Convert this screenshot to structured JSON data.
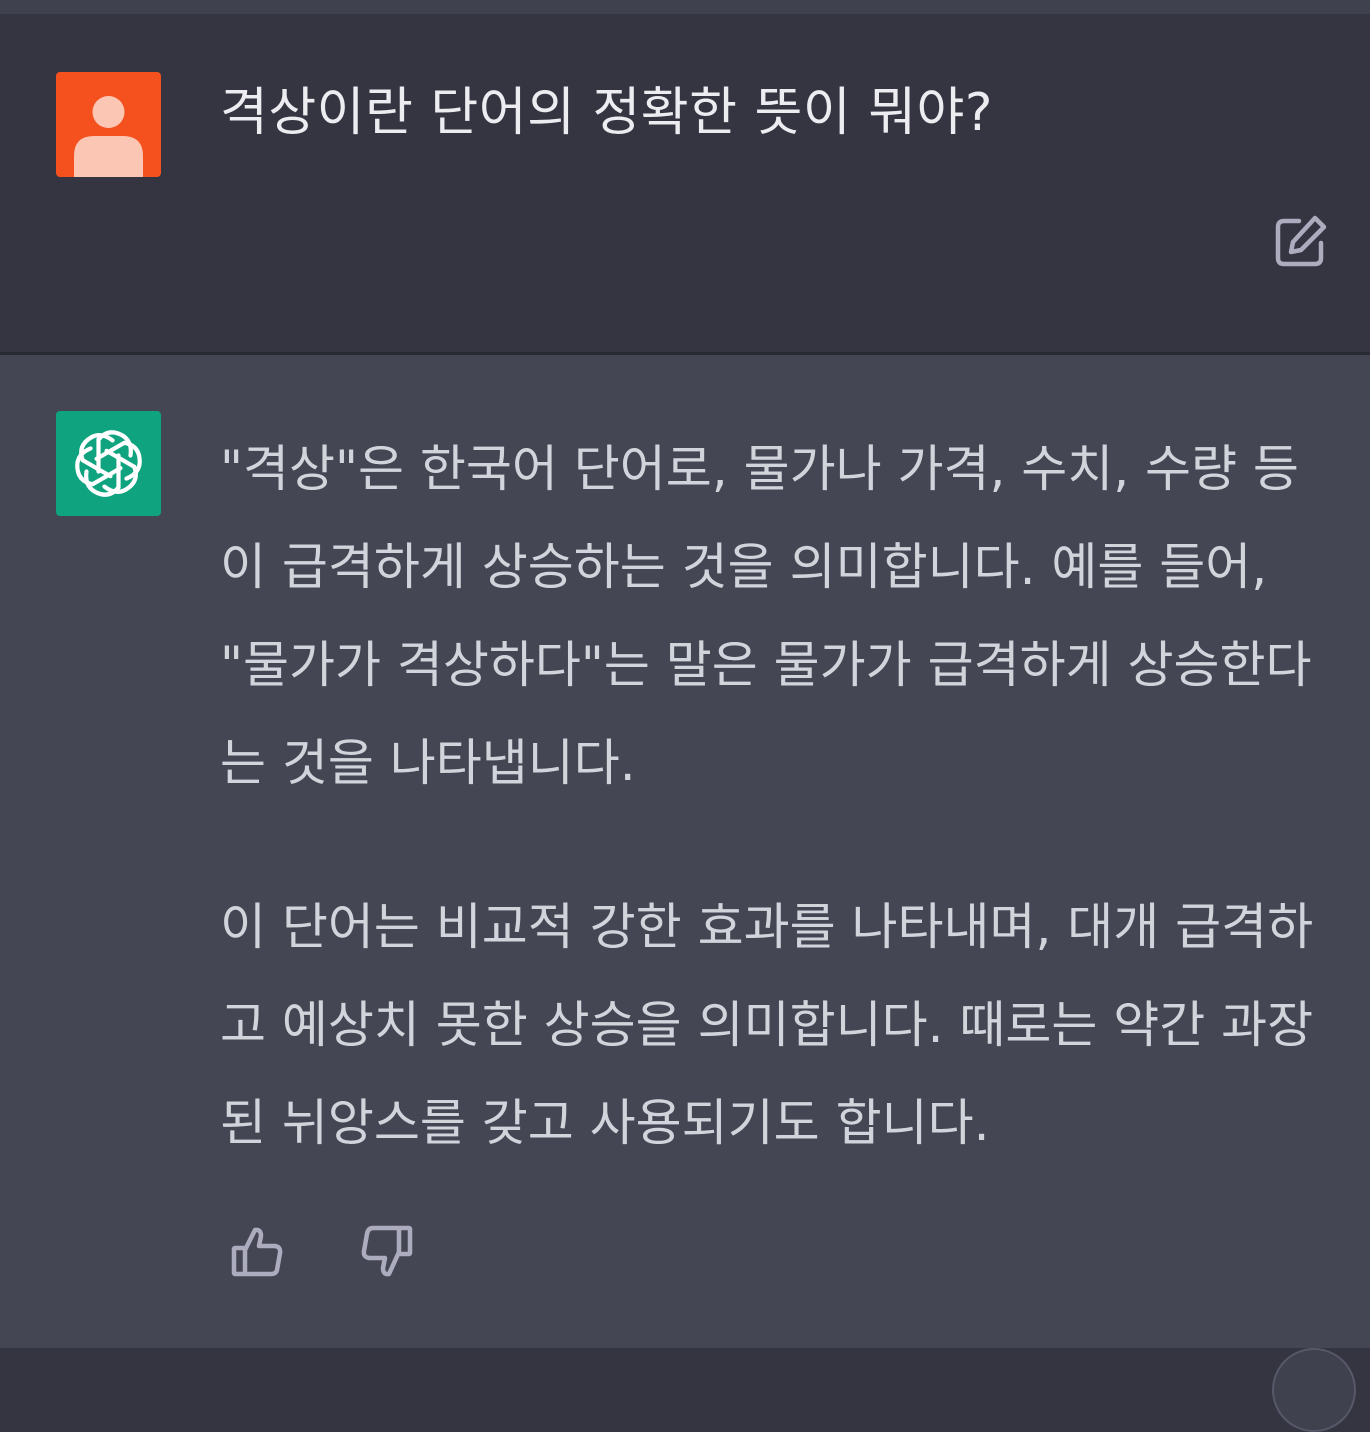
{
  "conversation": {
    "user_message": {
      "avatar": "user-avatar-icon",
      "text": "격상이란 단어의 정확한 뜻이 뭐야?"
    },
    "assistant_message": {
      "avatar": "openai-logo-icon",
      "paragraphs": [
        "\"격상\"은 한국어 단어로, 물가나 가격, 수치, 수량 등이 급격하게 상승하는 것을 의미합니다. 예를 들어, \"물가가 격상하다\"는 말은 물가가 급격하게 상승한다는 것을 나타냅니다.",
        "이 단어는 비교적 강한 효과를 나타내며, 대개 급격하고 예상치 못한 상승을 의미합니다. 때로는 약간 과장된 뉘앙스를 갖고 사용되기도 합니다."
      ]
    },
    "actions": {
      "edit": "edit-icon",
      "like": "thumbs-up-icon",
      "dislike": "thumbs-down-icon"
    }
  },
  "colors": {
    "user_bg": "#343541",
    "assistant_bg": "#444654",
    "user_avatar": "#f4511e",
    "gpt_avatar": "#10a37f",
    "text": "#d1d5db"
  }
}
